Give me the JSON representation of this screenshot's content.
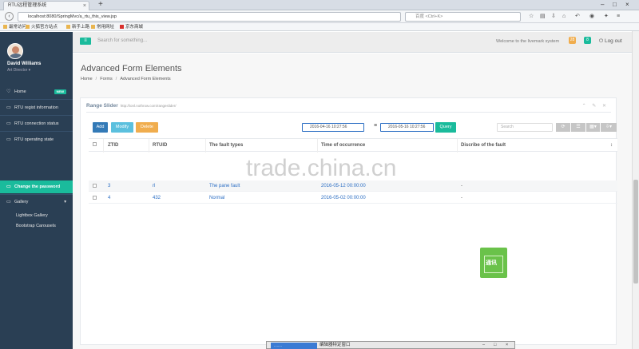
{
  "browser": {
    "tab_title": "RTU远程管理系统",
    "tab_close": "×",
    "new_tab": "+",
    "url": "localhost:8080/SpringMvc/a_rtu_this_view.jsp",
    "search_placeholder": "百度 <Ctrl+K>",
    "window_controls": [
      "–",
      "□",
      "×"
    ],
    "bookmarks": [
      "最常访问",
      "火狐官方站点",
      "新手上路",
      "常用网址",
      "京东商城"
    ]
  },
  "sidebar": {
    "user_name": "David Williams",
    "user_role": "Art Director ▾",
    "items": [
      {
        "icon": "♡",
        "label": "Home",
        "badge": "NEW"
      },
      {
        "icon": "▭",
        "label": "RTU regist information"
      },
      {
        "icon": "▭",
        "label": "RTU connection status"
      },
      {
        "icon": "▭",
        "label": "RTU operating state"
      }
    ],
    "active_item": {
      "icon": "▭",
      "label": "Change the password"
    },
    "gallery": {
      "icon": "▭",
      "label": "Gallery",
      "chevron": "▾"
    },
    "sub_items": [
      "Lightbox Gallery",
      "Bootstrap Carousels"
    ]
  },
  "topnav": {
    "toggle_icon": "≡",
    "search_placeholder": "Search for something...",
    "welcome": "Welcome to the livemark system",
    "notif_1": "28",
    "notif_2": "8",
    "logout": "Log out"
  },
  "page": {
    "title": "Advanced Form Elements",
    "breadcrumb": [
      "Home",
      "Forms",
      "Advanced Form Elements"
    ]
  },
  "panel": {
    "title": "Range Slider",
    "subtitle": "http://ionl.nothrow.com/rangeslider/",
    "tools": "⌃ ✎ ✕",
    "buttons": {
      "add": "Add",
      "modify": "Modify",
      "delete": "Delete",
      "query": "Query"
    },
    "date_from": "2016-04-16 10:27:56",
    "date_to": "2016-05-16 10:27:56",
    "date_sep": "≡",
    "table_search_placeholder": "Search",
    "table_tools": [
      "⟳",
      "☰",
      "▦▾",
      "⇩▾"
    ]
  },
  "table": {
    "columns": [
      "ZTID",
      "RTUID",
      "The fault types",
      "Time of occurrence",
      "Discribe of the fault"
    ],
    "sort_icon": "↕",
    "rows": [
      {
        "ztid": "3",
        "rtuid": "rl",
        "fault_type": "The pane fault",
        "time": "2016-05-12 00:00:00",
        "describe": "-"
      },
      {
        "ztid": "4",
        "rtuid": "432",
        "fault_type": "Normal",
        "time": "2016-05-02 00:00:00",
        "describe": "-"
      }
    ]
  },
  "overlay": {
    "watermark": "trade.china.cn",
    "qr_label": "通讯"
  },
  "taskbar": {
    "app_label": "........",
    "title": "编辑器特定窗口",
    "controls": [
      "–",
      "□",
      "×"
    ]
  },
  "colors": {
    "sidebar_bg": "#2a3f54",
    "accent_green": "#1abb9c",
    "btn_blue": "#337ab7",
    "btn_info": "#5bc0de",
    "btn_warning": "#f0ad4e",
    "link_blue": "#2d6fc4"
  }
}
